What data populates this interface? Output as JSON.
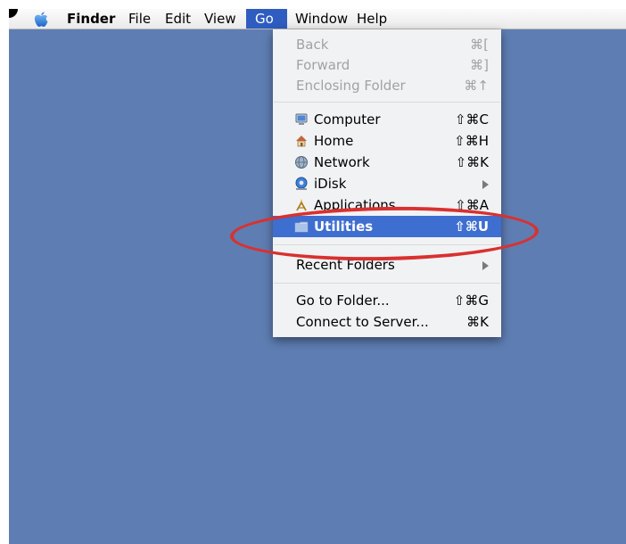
{
  "menubar": {
    "app_name": "Finder",
    "items": [
      "File",
      "Edit",
      "View",
      "Go",
      "Window",
      "Help"
    ],
    "active_item": "Go"
  },
  "go_menu": {
    "items": [
      {
        "label": "Back",
        "shortcut": "⌘[",
        "enabled": false
      },
      {
        "label": "Forward",
        "shortcut": "⌘]",
        "enabled": false
      },
      {
        "label": "Enclosing Folder",
        "shortcut": "⌘↑",
        "enabled": false
      },
      {
        "label": "Computer",
        "shortcut": "⇧⌘C",
        "icon": "computer-icon"
      },
      {
        "label": "Home",
        "shortcut": "⇧⌘H",
        "icon": "home-icon"
      },
      {
        "label": "Network",
        "shortcut": "⇧⌘K",
        "icon": "network-icon"
      },
      {
        "label": "iDisk",
        "icon": "idisk-icon",
        "submenu": true
      },
      {
        "label": "Applications",
        "shortcut": "⇧⌘A",
        "icon": "applications-icon"
      },
      {
        "label": "Utilities",
        "shortcut": "⇧⌘U",
        "icon": "utilities-folder-icon",
        "selected": true
      },
      {
        "label": "Recent Folders",
        "submenu": true
      },
      {
        "label": "Go to Folder...",
        "shortcut": "⇧⌘G"
      },
      {
        "label": "Connect to Server...",
        "shortcut": "⌘K"
      }
    ]
  },
  "colors": {
    "desktop": "#5e7db2",
    "menu_highlight": "#3e6ed0",
    "annotation": "#d9312f"
  }
}
